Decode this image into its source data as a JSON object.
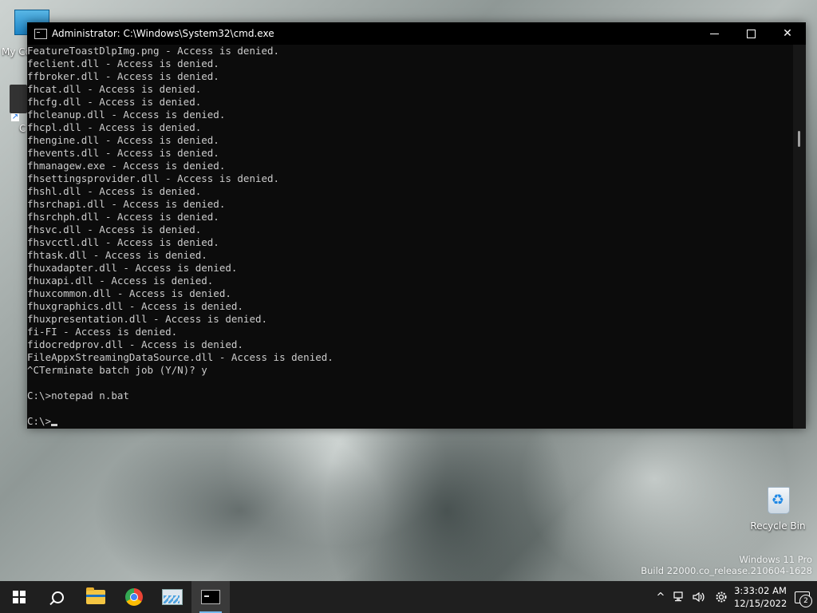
{
  "desktop": {
    "icons": {
      "my_computer": "My Co",
      "shortcut": "C",
      "recycle_bin": "Recycle Bin"
    },
    "watermark": {
      "edition": "Windows 11 Pro",
      "build": "Build 22000.co_release.210604-1628"
    }
  },
  "window": {
    "title": "Administrator:  C:\\Windows\\System32\\cmd.exe",
    "buttons": {
      "minimize": "—",
      "maximize": "☐",
      "close": "✕"
    }
  },
  "console": {
    "lines": [
      "FeatureToastDlpImg.png - Access is denied.",
      "feclient.dll - Access is denied.",
      "ffbroker.dll - Access is denied.",
      "fhcat.dll - Access is denied.",
      "fhcfg.dll - Access is denied.",
      "fhcleanup.dll - Access is denied.",
      "fhcpl.dll - Access is denied.",
      "fhengine.dll - Access is denied.",
      "fhevents.dll - Access is denied.",
      "fhmanagew.exe - Access is denied.",
      "fhsettingsprovider.dll - Access is denied.",
      "fhshl.dll - Access is denied.",
      "fhsrchapi.dll - Access is denied.",
      "fhsrchph.dll - Access is denied.",
      "fhsvc.dll - Access is denied.",
      "fhsvcctl.dll - Access is denied.",
      "fhtask.dll - Access is denied.",
      "fhuxadapter.dll - Access is denied.",
      "fhuxapi.dll - Access is denied.",
      "fhuxcommon.dll - Access is denied.",
      "fhuxgraphics.dll - Access is denied.",
      "fhuxpresentation.dll - Access is denied.",
      "fi-FI - Access is denied.",
      "fidocredprov.dll - Access is denied.",
      "FileAppxStreamingDataSource.dll - Access is denied.",
      "^CTerminate batch job (Y/N)? y",
      "",
      "C:\\>notepad n.bat",
      ""
    ],
    "prompt": "C:\\>"
  },
  "taskbar": {
    "apps": [
      "start-icon",
      "search-icon",
      "file-explorer-icon",
      "chrome-icon",
      "performance-monitor-icon",
      "command-prompt-icon"
    ],
    "tray": {
      "chevron": "^",
      "time": "3:33:02 AM",
      "date": "12/15/2022",
      "notification_count": "2"
    }
  }
}
